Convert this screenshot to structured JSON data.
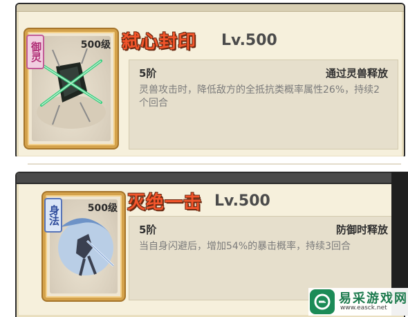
{
  "skills": [
    {
      "badge": "御灵",
      "card_level": "500级",
      "name": "弑心封印",
      "level": "Lv.500",
      "tier": "5阶",
      "trigger": "通过灵兽释放",
      "description": "灵兽攻击时，降低敌方的全抵抗类概率属性26%，持续2个回合"
    },
    {
      "badge": "身法",
      "card_level": "500级",
      "name": "灭绝一击",
      "level": "Lv.500",
      "tier": "5阶",
      "trigger": "防御时释放",
      "description": "当自身闪避后，增加54%的暴击概率，持续3回合"
    }
  ],
  "watermark": {
    "title": "易采游戏网",
    "url": "www.easck.net",
    "icon": "easck-logo-icon"
  },
  "colors": {
    "skill_title": "#f3552b",
    "card_frame": "#d4a24b",
    "panel_bg": "#f6f0dc",
    "badge_pink": "#c25a96",
    "badge_blue": "#5774b8",
    "watermark_green": "#1c8b57"
  }
}
